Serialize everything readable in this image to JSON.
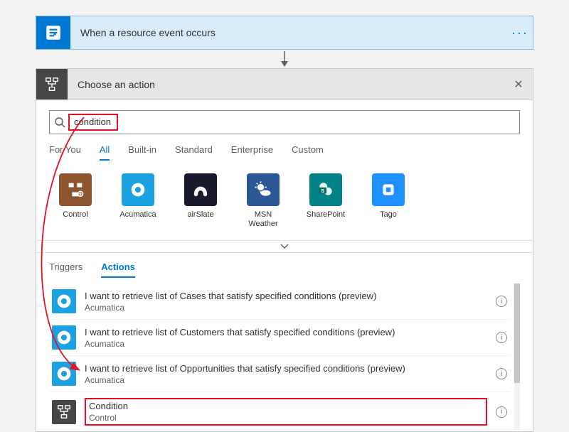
{
  "trigger": {
    "title": "When a resource event occurs"
  },
  "panel": {
    "title": "Choose an action"
  },
  "search": {
    "value": "condition"
  },
  "categoryTabs": [
    "For You",
    "All",
    "Built-in",
    "Standard",
    "Enterprise",
    "Custom"
  ],
  "categoryActive": "All",
  "connectors": [
    {
      "label": "Control",
      "bg": "#8e562e",
      "glyph": "control"
    },
    {
      "label": "Acumatica",
      "bg": "#1ba1e2",
      "glyph": "acumatica"
    },
    {
      "label": "airSlate",
      "bg": "#1a1a2e",
      "glyph": "airslate"
    },
    {
      "label": "MSN Weather",
      "bg": "#2b5797",
      "glyph": "weather"
    },
    {
      "label": "SharePoint",
      "bg": "#028387",
      "glyph": "sharepoint"
    },
    {
      "label": "Tago",
      "bg": "#1e90ff",
      "glyph": "tago"
    }
  ],
  "subTabs": [
    "Triggers",
    "Actions"
  ],
  "subActive": "Actions",
  "actions": [
    {
      "title": "I want to retrieve list of Cases that satisfy specified conditions (preview)",
      "sub": "Acumatica",
      "bg": "#1ba1e2",
      "glyph": "acumatica"
    },
    {
      "title": "I want to retrieve list of Customers that satisfy specified conditions (preview)",
      "sub": "Acumatica",
      "bg": "#1ba1e2",
      "glyph": "acumatica"
    },
    {
      "title": "I want to retrieve list of Opportunities that satisfy specified conditions (preview)",
      "sub": "Acumatica",
      "bg": "#1ba1e2",
      "glyph": "acumatica"
    },
    {
      "title": "Condition",
      "sub": "Control",
      "bg": "#484644",
      "glyph": "control-light",
      "highlight": true
    }
  ]
}
